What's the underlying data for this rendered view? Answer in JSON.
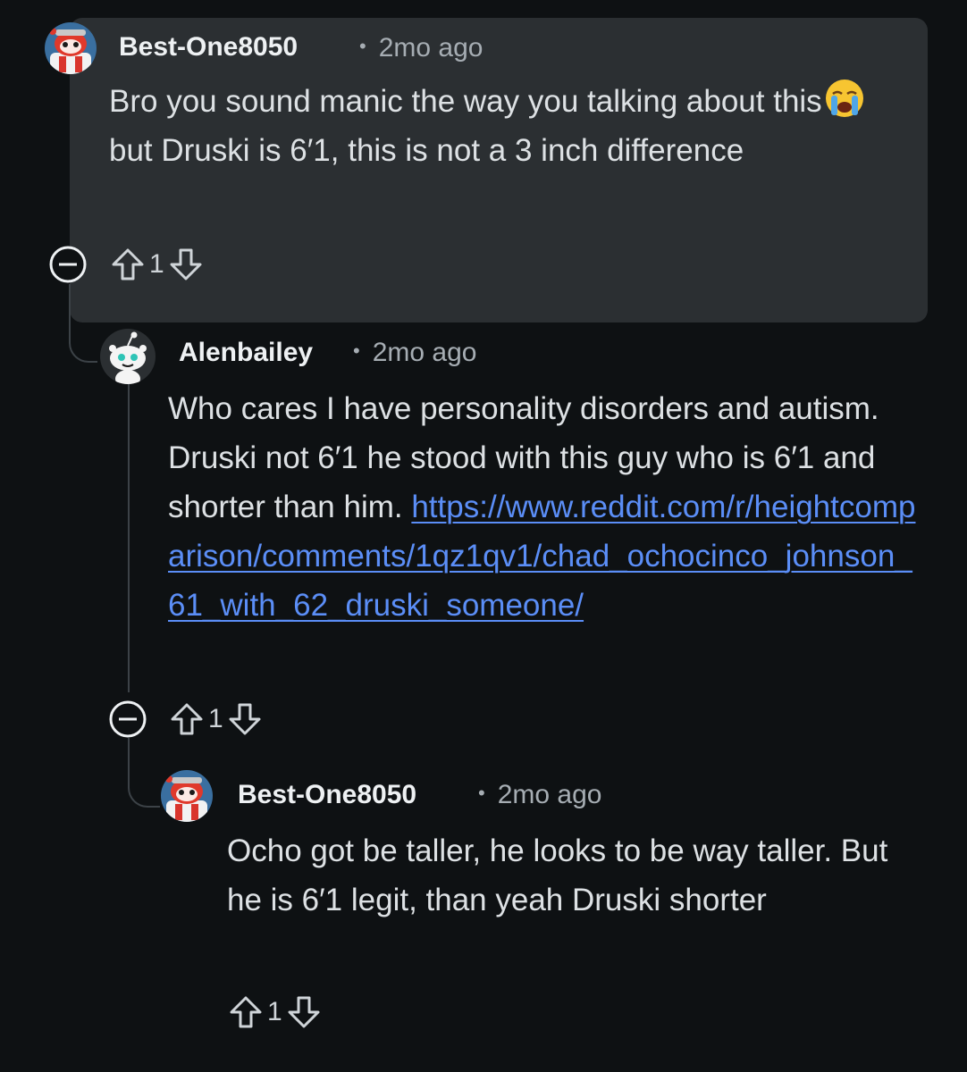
{
  "comments": [
    {
      "author": "Best-One8050",
      "time": "2mo ago",
      "body_parts": [
        "Bro you sound manic the way you talking about this",
        " but Druski is 6′1, this is not a 3 inch difference"
      ],
      "emoji": "loudly-crying-face",
      "votes": "1",
      "highlighted": true
    },
    {
      "author": "Alenbailey",
      "time": "2mo ago",
      "body": "Who cares I have personality disorders and autism. Druski not 6′1 he stood with this guy who is 6′1 and shorter than him. ",
      "link": "https://www.reddit.com/r/heightcomparison/comments/1qz1qv1/chad_ochocinco_johnson_61_with_62_druski_someone/",
      "votes": "1"
    },
    {
      "author": "Best-One8050",
      "time": "2mo ago",
      "body": "Ocho got be taller, he looks to be way taller. But he is 6′1 legit, than yeah Druski shorter",
      "votes": "1"
    }
  ],
  "separator": "•",
  "icons": {
    "collapse": "collapse-minus-icon",
    "upvote": "upvote-arrow-icon",
    "downvote": "downvote-arrow-icon"
  },
  "colors": {
    "background": "#0e1113",
    "highlight": "#2b2f32",
    "link": "#5b8ef7"
  }
}
